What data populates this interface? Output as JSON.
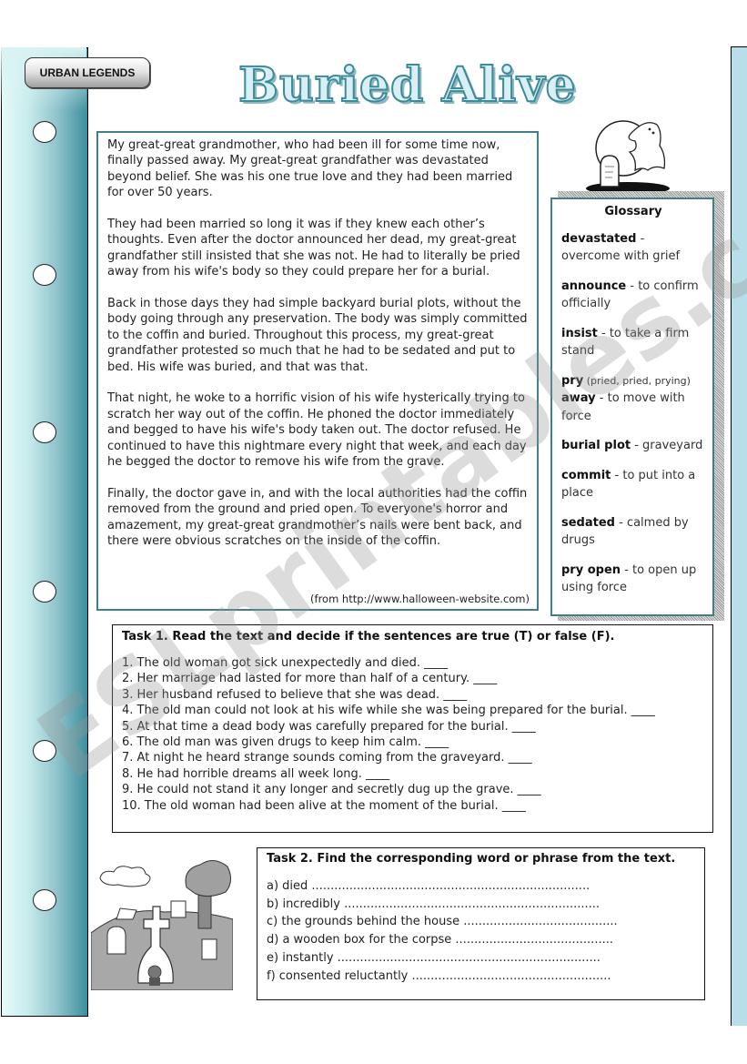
{
  "header": {
    "tag_label": "URBAN LEGENDS",
    "title": "Buried Alive"
  },
  "story": {
    "paragraphs": [
      "My great-great grandmother, who had been ill for some time now, finally passed away. My great-great grandfather was devastated beyond belief. She was his one true love and they had been married for over 50 years.",
      "They had been married so long it was if they knew each other’s thoughts. Even after the doctor announced her dead, my great-great grandfather still insisted that she was not. He had to literally be pried away from his wife's body so they could prepare her for a burial.",
      "Back in those days they had simple backyard burial plots, without the body going through any preservation. The body was simply committed to the coffin and buried. Throughout this process, my great-great grandfather protested so much that he had to be sedated and put to bed. His wife was buried, and that was that.",
      "That night, he woke to a horrific vision of his wife hysterically trying to scratch her way out of the coffin. He phoned the doctor immediately and begged to have his wife's body taken out. The doctor refused. He continued to have this nightmare every night that week, and each day he begged the doctor to remove his wife from the grave.",
      "Finally, the doctor gave in, and with the local authorities had the coffin removed from the ground and pried open. To everyone's horror and amazement, my great-great grandmother’s nails were bent back, and there were obvious scratches on the inside of the coffin."
    ],
    "source": "(from http://www.halloween-website.com)"
  },
  "glossary": {
    "title": "Glossary",
    "entries": [
      {
        "term": "devastated",
        "extra": "",
        "term2": "",
        "definition": " - overcome with grief"
      },
      {
        "term": "announce",
        "extra": "",
        "term2": "",
        "definition": " - to confirm officially"
      },
      {
        "term": "insist",
        "extra": "",
        "term2": "",
        "definition": " - to take a firm stand"
      },
      {
        "term": "pry",
        "extra": " (pried, pried, prying)",
        "term2": "away",
        "definition": " - to move with force"
      },
      {
        "term": "burial plot",
        "extra": "",
        "term2": "",
        "definition": " - graveyard"
      },
      {
        "term": "commit",
        "extra": "",
        "term2": "",
        "definition": " - to put into a place"
      },
      {
        "term": "sedated",
        "extra": "",
        "term2": "",
        "definition": " - calmed by drugs"
      },
      {
        "term": "pry open",
        "extra": "",
        "term2": "",
        "definition": " - to open up using force"
      }
    ]
  },
  "task1": {
    "heading": "Task 1. Read the text and decide if the sentences are true (T) or false (F).",
    "items": [
      "1. The old woman got sick unexpectedly and died. ____",
      "2. Her marriage had lasted for more than half of a century. ____",
      "3. Her husband refused to believe that she was dead. ____",
      "4. The old man could not look at his wife while she was being prepared for the burial. ____",
      "5. At that time a dead body was carefully prepared for the burial. ____",
      "6. The old man was given drugs to keep him calm. ____",
      "7. At night he heard strange sounds coming from the graveyard. ____",
      "8. He had horrible dreams all week long. ____",
      "9. He could not stand it any longer and secretly dug up the grave. ____",
      "10. The old woman had been alive at the moment of the burial. ____"
    ]
  },
  "task2": {
    "heading": "Task 2. Find the corresponding word or phrase from the text.",
    "items": [
      "a) died ..........................................................................",
      "b) incredibly ....................................................................",
      "c) the grounds behind the house .........................................",
      "d) a wooden box for the corpse ..........................................",
      "e) instantly ......................................................................",
      "f) consented reluctantly ....................................................."
    ]
  },
  "watermark": "ESLprintables.com",
  "icons": {
    "ghost_illustration": "ghost-tombstone-icon",
    "graveyard_illustration": "graveyard-icon"
  }
}
